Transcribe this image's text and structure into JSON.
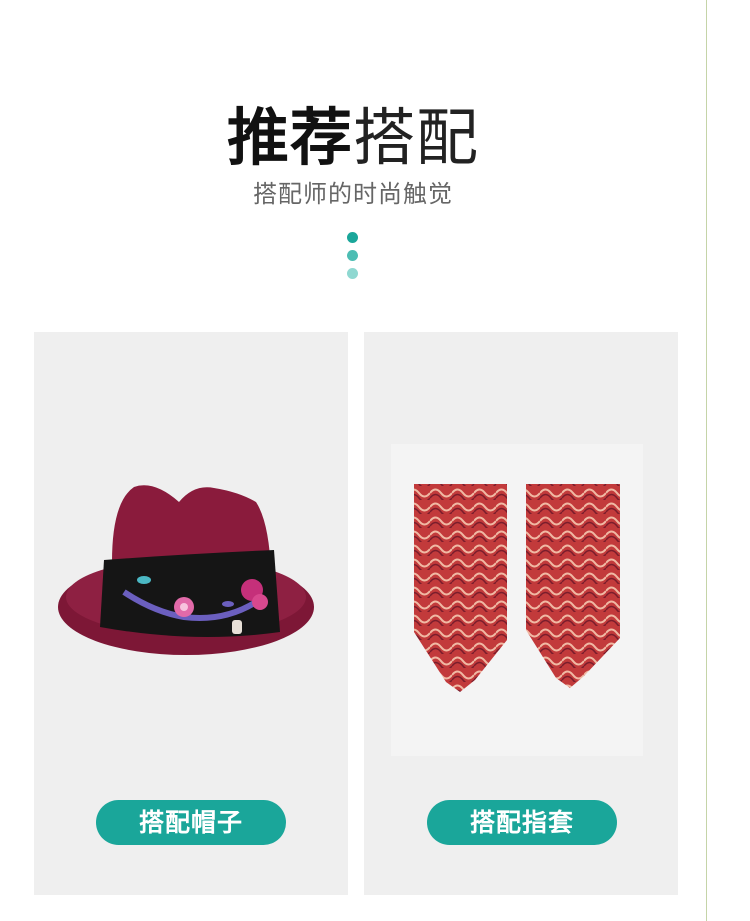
{
  "header": {
    "title_bold": "推荐",
    "title_light": "搭配",
    "subtitle": "搭配师的时尚触觉"
  },
  "colors": {
    "accent": "#1aa69a",
    "dot1": "#1aa69a",
    "dot2": "#4cbdb3",
    "dot3": "#8fd8d1",
    "card_bg": "#efefef",
    "hat_crown": "#8a1b3c",
    "hat_band": "#141414",
    "pattern_red": "#c23a3b"
  },
  "cards": [
    {
      "image": "hat-image",
      "button_label": "搭配帽子"
    },
    {
      "image": "gloves-image",
      "button_label": "搭配指套"
    }
  ]
}
